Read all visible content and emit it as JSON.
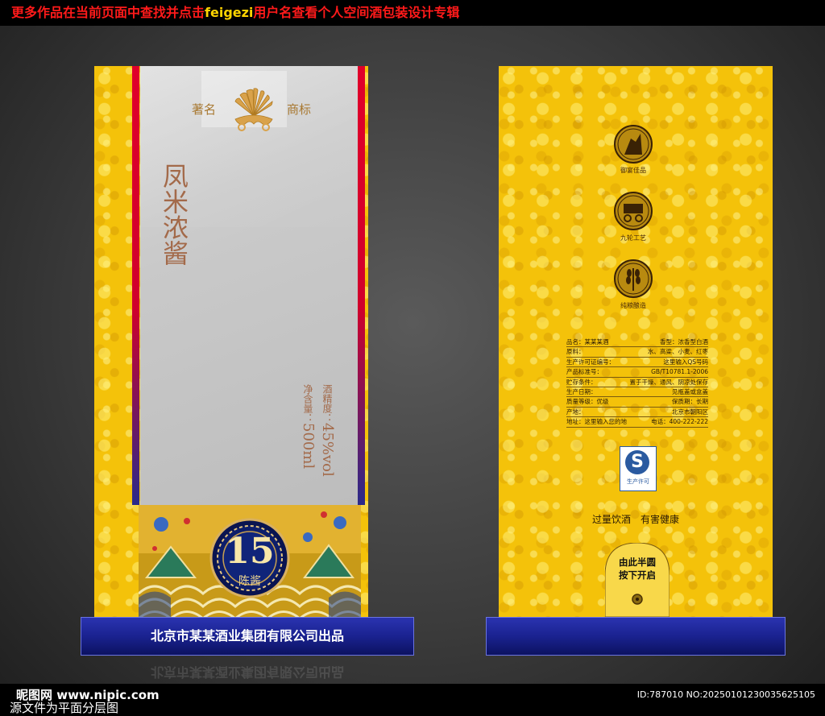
{
  "banner": {
    "prefix": "更多作品在当前页面中查找并点击",
    "highlight": "feigezi",
    "suffix": "用户名查看个人空间酒包装设计专辑"
  },
  "front": {
    "brand_left": "著名",
    "brand_right": "商标",
    "product_name": "凤米浓酱",
    "alcohol_label": "酒精度：",
    "alcohol_value": "45%vol",
    "volume_label": "净含量：",
    "volume_value": "500ml",
    "badge_number": "15",
    "badge_text": "陈酱",
    "company": "北京市某某酒业集团有限公司出品"
  },
  "back": {
    "medallions": [
      {
        "caption": "御宴佳品",
        "icon": "warrior-icon"
      },
      {
        "caption": "九轮工艺",
        "icon": "cart-icon"
      },
      {
        "caption": "纯粮酿造",
        "icon": "grain-icon"
      }
    ],
    "info": [
      {
        "l": "品名：某某某酒",
        "r": "香型：浓香型白酒"
      },
      {
        "l": "原料：",
        "r": "水、高粱、小麦、红枣"
      },
      {
        "l": "生产许可证编号：",
        "r": "这里输入QS号码"
      },
      {
        "l": "产品标准号：",
        "r": "GB/T10781.1-2006"
      },
      {
        "l": "贮存条件：",
        "r": "置于干燥、通风、阴凉处保存"
      },
      {
        "l": "生产日期：",
        "r": "见瓶盖或盒盖"
      },
      {
        "l": "质量等级：优级",
        "r": "保质期：长期"
      },
      {
        "l": "产地：",
        "r": "北京市朝阳区"
      },
      {
        "l": "地址：这里输入您的地",
        "r": "电话：400-222-222"
      }
    ],
    "qs_letter": "S",
    "qs_label": "生产许可",
    "warning": "过量饮酒　有害健康",
    "open_line1": "由此半圆",
    "open_line2": "按下开启"
  },
  "watermark": {
    "site": "昵图网 www.nipic.com",
    "bottom_text": "源文件为平面分层图",
    "id_text": "ID:787010 NO:20250101230035625105"
  },
  "colors": {
    "gold": "#f4c20a",
    "navy": "#1a2290",
    "red_stripe": "#e0002a",
    "product_text": "#a36a4a",
    "banner_red": "#ff1a1a",
    "banner_yellow": "#ffd400"
  }
}
